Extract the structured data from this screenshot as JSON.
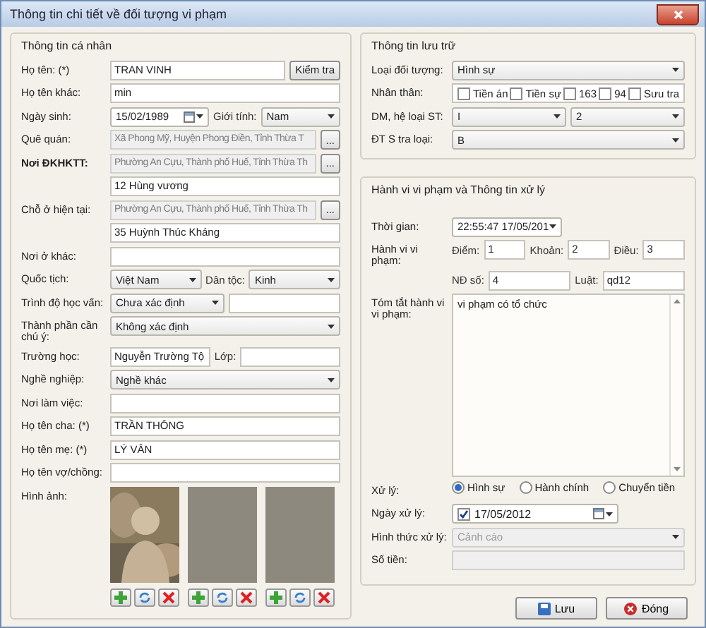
{
  "window": {
    "title": "Thông tin chi tiết về đối tượng vi phạm"
  },
  "personal": {
    "title": "Thông tin cá nhân",
    "rows": [
      {
        "label": "Họ tên: (*)",
        "fields": [
          {
            "kind": "text",
            "value": "TRAN VINH"
          },
          {
            "kind": "button",
            "value": "Kiểm tra"
          }
        ]
      },
      {
        "label": "Họ tên khác:",
        "fields": [
          {
            "kind": "text",
            "value": "min"
          }
        ]
      },
      {
        "label": "Ngày sinh:",
        "fields": [
          {
            "kind": "date",
            "value": "15/02/1989"
          },
          {
            "kind": "label",
            "value": "Giới tính:"
          },
          {
            "kind": "select",
            "value": "Nam"
          }
        ]
      },
      {
        "label": "Quê quán:",
        "fields": [
          {
            "kind": "text",
            "value": "Xã Phong Mỹ, Huyện Phong Điền, Tỉnh Thừa T",
            "disabled": true
          },
          {
            "kind": "button",
            "value": "..."
          }
        ]
      },
      {
        "label": "Nơi ĐKHKTT:",
        "bold": true,
        "fields": [
          {
            "kind": "text",
            "value": "Phường An Cựu, Thành phố Huế, Tỉnh Thừa Th",
            "disabled": true
          },
          {
            "kind": "button",
            "value": "..."
          }
        ]
      },
      {
        "fields": [
          {
            "kind": "text",
            "value": "12 Hùng vương"
          }
        ]
      },
      {
        "label": "Chỗ ở hiện tại:",
        "fields": [
          {
            "kind": "text",
            "value": "Phường An Cựu, Thành phố Huế, Tỉnh Thừa Th",
            "disabled": true
          },
          {
            "kind": "button",
            "value": "..."
          }
        ]
      },
      {
        "fields": [
          {
            "kind": "text",
            "value": "35 Huỳnh Thúc Kháng"
          }
        ]
      },
      {
        "label": "Nơi ở khác:",
        "fields": [
          {
            "kind": "text"
          }
        ]
      },
      {
        "label": "Quốc tịch:",
        "fields": [
          {
            "kind": "select",
            "value": "Việt Nam"
          },
          {
            "kind": "label",
            "value": "Dân tộc:"
          },
          {
            "kind": "select",
            "value": "Kinh"
          }
        ]
      },
      {
        "label": "Trình độ học vấn:",
        "fields": [
          {
            "kind": "select",
            "value": "Chưa xác định"
          },
          {
            "kind": "text"
          }
        ]
      },
      {
        "label": "Thành phần cần chú ý:",
        "fields": [
          {
            "kind": "select",
            "value": "Không xác định"
          }
        ]
      },
      {
        "label": "Trường học:",
        "fields": [
          {
            "kind": "text",
            "value": "Nguyễn Trường Tộ"
          },
          {
            "kind": "label",
            "value": "Lớp:"
          },
          {
            "kind": "text"
          }
        ]
      },
      {
        "label": "Nghề nghiệp:",
        "fields": [
          {
            "kind": "select",
            "value": "Nghề khác"
          }
        ]
      },
      {
        "label": "Nơi làm việc:",
        "fields": [
          {
            "kind": "text"
          }
        ]
      },
      {
        "label": "Họ tên cha: (*)",
        "fields": [
          {
            "kind": "text",
            "value": "TRẦN THÔNG"
          }
        ]
      },
      {
        "label": "Họ tên mẹ: (*)",
        "fields": [
          {
            "kind": "text",
            "value": "LÝ VÂN"
          }
        ]
      },
      {
        "label": "Họ tên vợ/chồng:",
        "fields": [
          {
            "kind": "text"
          }
        ]
      }
    ],
    "photos": {
      "label": "Hình ảnh:",
      "items": [
        {
          "kind": "picture"
        },
        {
          "kind": "empty"
        },
        {
          "kind": "empty"
        }
      ]
    }
  },
  "storage": {
    "title": "Thông tin lưu trữ",
    "rows": [
      {
        "label": "Loại đối tượng:",
        "fields": [
          {
            "kind": "select",
            "value": "Hình sự"
          }
        ]
      },
      {
        "label": "Nhân thân:",
        "fields": [
          {
            "kind": "checks",
            "items": [
              {
                "label": "Tiền án",
                "checked": false
              },
              {
                "label": "Tiền sự",
                "checked": false
              },
              {
                "label": "163",
                "checked": false
              },
              {
                "label": "94",
                "checked": false
              },
              {
                "label": "Sưu tra",
                "checked": false
              }
            ]
          }
        ]
      },
      {
        "label": "DM, hệ loại ST:",
        "fields": [
          {
            "kind": "select",
            "value": "I"
          },
          {
            "kind": "select",
            "value": "2"
          }
        ]
      },
      {
        "label": "ĐT S tra loại:",
        "fields": [
          {
            "kind": "select",
            "value": "B"
          }
        ]
      }
    ]
  },
  "violation": {
    "title": "Hành vi vi phạm và Thông tin xử lý",
    "rows": [
      {
        "label": "Thời gian:",
        "fields": [
          {
            "kind": "datetime",
            "value": "22:55:47 17/05/201"
          }
        ]
      },
      {
        "label": "Hành vi vi phạm:",
        "fields": [
          {
            "kind": "label",
            "value": "Điểm:"
          },
          {
            "kind": "text",
            "value": "1"
          },
          {
            "kind": "label",
            "value": "Khoản:"
          },
          {
            "kind": "text",
            "value": "2"
          },
          {
            "kind": "label",
            "value": "Điều:"
          },
          {
            "kind": "text",
            "value": "3"
          }
        ]
      },
      {
        "fields": [
          {
            "kind": "label",
            "value": "NĐ số:"
          },
          {
            "kind": "text",
            "value": "4"
          },
          {
            "kind": "label",
            "value": "Luật:"
          },
          {
            "kind": "text",
            "value": "qd12"
          }
        ]
      },
      {
        "label": "Tóm tắt hành vi vi phạm:",
        "fields": [
          {
            "kind": "textarea",
            "value": "vi phạm có tổ chức"
          }
        ]
      },
      {
        "label": "Xử lý:",
        "fields": [
          {
            "kind": "radios",
            "items": [
              {
                "label": "Hình sự",
                "selected": true
              },
              {
                "label": "Hành chính",
                "selected": false
              },
              {
                "label": "Chuyển tiền",
                "selected": false
              }
            ]
          }
        ]
      },
      {
        "label": "Ngày xử lý:",
        "fields": [
          {
            "kind": "checkdate",
            "checked": true,
            "value": "17/05/2012"
          }
        ]
      },
      {
        "label": "Hình thức xử lý:",
        "fields": [
          {
            "kind": "select",
            "value": "Cảnh cáo",
            "disabled": true
          }
        ]
      },
      {
        "label": "Số tiền:",
        "fields": [
          {
            "kind": "text",
            "disabled": true
          }
        ]
      }
    ]
  },
  "buttons": [
    {
      "kind": "save",
      "label": "Lưu"
    },
    {
      "kind": "close",
      "label": "Đóng"
    }
  ]
}
